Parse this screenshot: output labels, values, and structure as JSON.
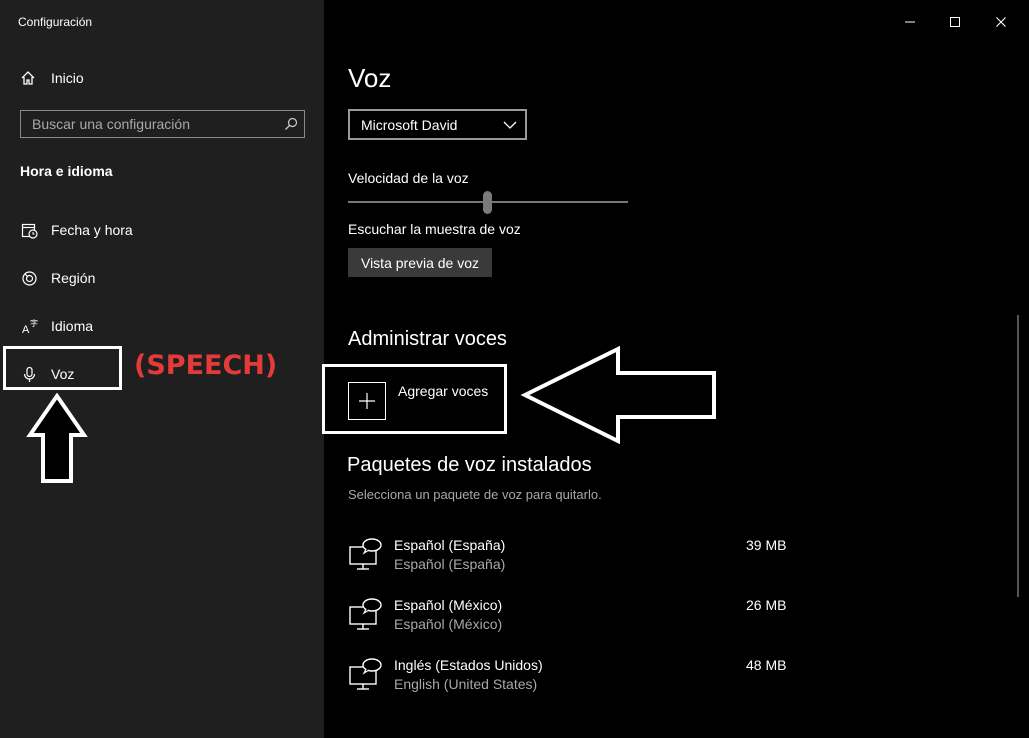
{
  "window": {
    "title": "Configuración",
    "minimize_icon": "minimize-icon",
    "maximize_icon": "maximize-icon",
    "close_icon": "close-icon"
  },
  "sidebar": {
    "home_label": "Inicio",
    "search_placeholder": "Buscar una configuración",
    "section_title": "Hora e idioma",
    "items": [
      {
        "label": "Fecha y hora",
        "icon": "calendar-clock-icon"
      },
      {
        "label": "Región",
        "icon": "globe-icon"
      },
      {
        "label": "Idioma",
        "icon": "language-icon"
      },
      {
        "label": "Voz",
        "icon": "microphone-icon"
      }
    ]
  },
  "annotation": {
    "speech_label": "(SPEECH)"
  },
  "main": {
    "title": "Voz",
    "voice_selected": "Microsoft David",
    "speed_label": "Velocidad de la voz",
    "speed_value": 0.5,
    "sample_label": "Escuchar la muestra de voz",
    "preview_button": "Vista previa de voz",
    "manage_title": "Administrar voces",
    "add_voices_label": "Agregar voces",
    "installed_title": "Paquetes de voz instalados",
    "installed_subtitle": "Selecciona un paquete de voz para quitarlo.",
    "packs": [
      {
        "name": "Español (España)",
        "sub": "Español (España)",
        "size": "39 MB"
      },
      {
        "name": "Español (México)",
        "sub": "Español (México)",
        "size": "26 MB"
      },
      {
        "name": "Inglés (Estados Unidos)",
        "sub": "English (United States)",
        "size": "48 MB"
      }
    ]
  },
  "colors": {
    "sidebar_bg": "#1f1f1f",
    "main_bg": "#000000",
    "annotation_red": "#e53a3a"
  }
}
